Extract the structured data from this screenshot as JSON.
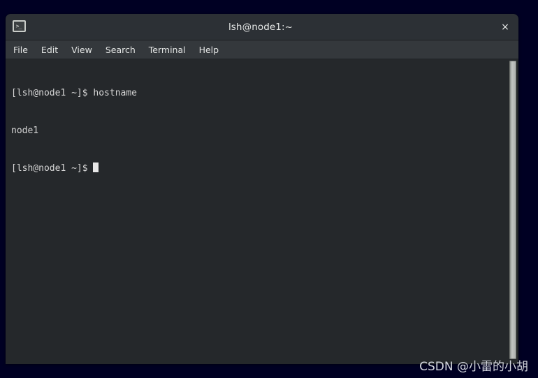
{
  "desktop": {
    "background_color": "#000023"
  },
  "window": {
    "title": "lsh@node1:~",
    "icon_name": "terminal-window-icon",
    "icon_glyph": ">_",
    "close_label": "×",
    "titlebar_color": "#2c3035",
    "menubar_color": "#34383c",
    "terminal_background": "#25282b"
  },
  "menu": {
    "items": [
      {
        "label": "File"
      },
      {
        "label": "Edit"
      },
      {
        "label": "View"
      },
      {
        "label": "Search"
      },
      {
        "label": "Terminal"
      },
      {
        "label": "Help"
      }
    ]
  },
  "terminal": {
    "text_color": "#d6d6d6",
    "lines": [
      "[lsh@node1 ~]$ hostname",
      "node1"
    ],
    "prompt": "[lsh@node1 ~]$ ",
    "cursor": "block"
  },
  "scrollbar": {
    "orientation": "vertical",
    "thumb_color": "#c2c5c2"
  },
  "watermark": {
    "text": "CSDN @小雷的小胡"
  }
}
